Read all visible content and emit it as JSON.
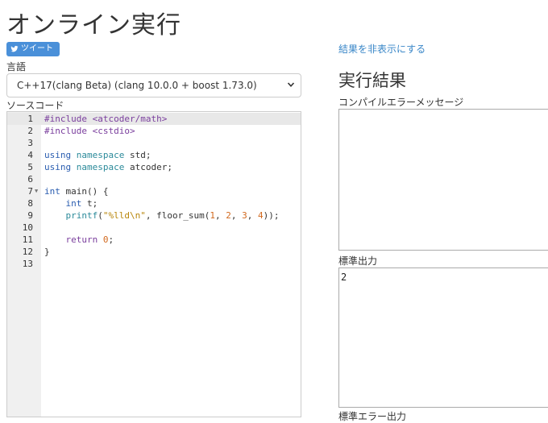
{
  "page": {
    "title": "オンライン実行"
  },
  "tweet": {
    "label": "ツイート"
  },
  "language": {
    "label": "言語",
    "selected": "C++17(clang Beta) (clang 10.0.0 + boost 1.73.0)"
  },
  "source": {
    "label": "ソースコード",
    "lines": [
      {
        "no": "1",
        "html": "<span class=\"kw-pre\">#include</span> <span class=\"kw-pre\">&lt;atcoder/math&gt;</span>",
        "active": true
      },
      {
        "no": "2",
        "html": "<span class=\"kw-pre\">#include</span> <span class=\"kw-pre\">&lt;cstdio&gt;</span>"
      },
      {
        "no": "3",
        "html": ""
      },
      {
        "no": "4",
        "html": "<span class=\"kw-type\">using</span> <span class=\"kw-std\">namespace</span> std;"
      },
      {
        "no": "5",
        "html": "<span class=\"kw-type\">using</span> <span class=\"kw-std\">namespace</span> atcoder;"
      },
      {
        "no": "6",
        "html": ""
      },
      {
        "no": "7",
        "html": "<span class=\"kw-type\">int</span> main() {",
        "fold": true
      },
      {
        "no": "8",
        "html": "    <span class=\"kw-type\">int</span> t;"
      },
      {
        "no": "9",
        "html": "    <span class=\"kw-std\">printf</span>(<span class=\"str\">\"%lld\\n\"</span>, floor_sum(<span class=\"num\">1</span>, <span class=\"num\">2</span>, <span class=\"num\">3</span>, <span class=\"num\">4</span>));"
      },
      {
        "no": "10",
        "html": ""
      },
      {
        "no": "11",
        "html": "    <span class=\"kw-ctl\">return</span> <span class=\"num\">0</span>;"
      },
      {
        "no": "12",
        "html": "}"
      },
      {
        "no": "13",
        "html": ""
      }
    ]
  },
  "results": {
    "hide_link": "結果を非表示にする",
    "heading": "実行結果",
    "compile_error_label": "コンパイルエラーメッセージ",
    "compile_error_value": "",
    "stdout_label": "標準出力",
    "stdout_value": "2",
    "stderr_label": "標準エラー出力"
  },
  "colors": {
    "tweet_bg": "#4a90d9",
    "link": "#3a87c8"
  },
  "icons": {
    "tweet": "twitter-bird-icon",
    "select": "chevron-down-icon",
    "fold": "fold-triangle-icon"
  }
}
